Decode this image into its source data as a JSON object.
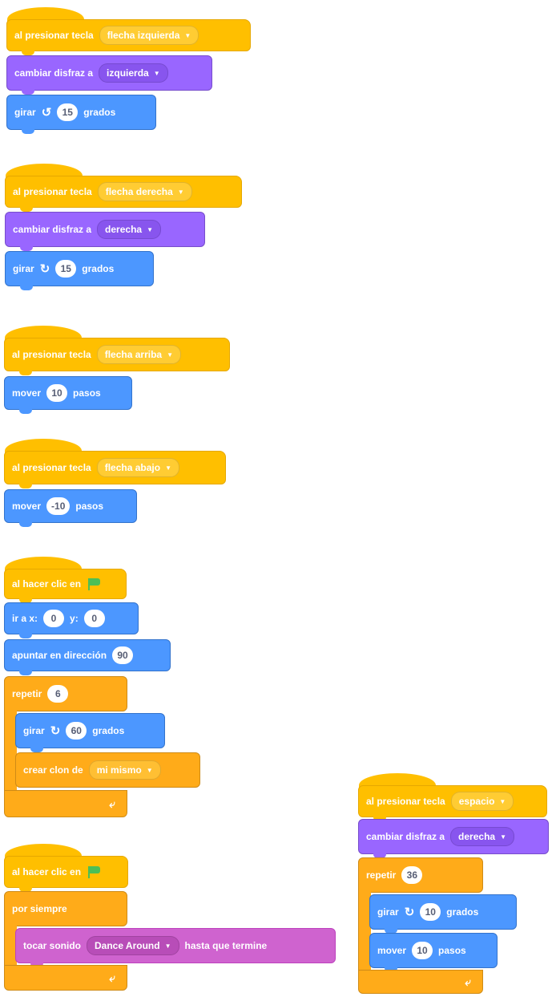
{
  "scripts": [
    {
      "hat": "al presionar tecla",
      "key": "flecha izquierda",
      "costume_label": "cambiar disfraz a",
      "costume": "izquierda",
      "turn_label": "girar",
      "turn_dir": "↺",
      "turn_value": "15",
      "turn_unit": "grados"
    },
    {
      "hat": "al presionar tecla",
      "key": "flecha derecha",
      "costume_label": "cambiar disfraz a",
      "costume": "derecha",
      "turn_label": "girar",
      "turn_dir": "↻",
      "turn_value": "15",
      "turn_unit": "grados"
    },
    {
      "hat": "al presionar tecla",
      "key": "flecha arriba",
      "move_label": "mover",
      "move_value": "10",
      "move_unit": "pasos"
    },
    {
      "hat": "al presionar tecla",
      "key": "flecha abajo",
      "move_label": "mover",
      "move_value": "-10",
      "move_unit": "pasos"
    },
    {
      "hat": "al hacer clic en",
      "goto_label": "ir a x:",
      "x": "0",
      "y_label": "y:",
      "y": "0",
      "point_label": "apuntar en dirección",
      "point_value": "90",
      "repeat_label": "repetir",
      "repeat_value": "6",
      "turn_label": "girar",
      "turn_dir": "↻",
      "turn_value": "60",
      "turn_unit": "grados",
      "clone_label": "crear clon de",
      "clone_value": "mi mismo",
      "loop_arrow": "⤶"
    },
    {
      "hat": "al hacer clic en",
      "forever_label": "por siempre",
      "sound_label": "tocar sonido",
      "sound_value": "Dance Around",
      "sound_until": "hasta que termine",
      "loop_arrow": "⤶"
    },
    {
      "hat": "al presionar tecla",
      "key": "espacio",
      "costume_label": "cambiar disfraz a",
      "costume": "derecha",
      "repeat_label": "repetir",
      "repeat_value": "36",
      "turn_label": "girar",
      "turn_dir": "↻",
      "turn_value": "10",
      "turn_unit": "grados",
      "move_label": "mover",
      "move_value": "10",
      "move_unit": "pasos",
      "loop_arrow": "⤶"
    }
  ],
  "dropdown_arrow": "▼",
  "colors": {
    "events": "#ffbf00",
    "looks": "#9966ff",
    "motion": "#4c97ff",
    "control": "#ffab19",
    "sound": "#cf63cf"
  }
}
